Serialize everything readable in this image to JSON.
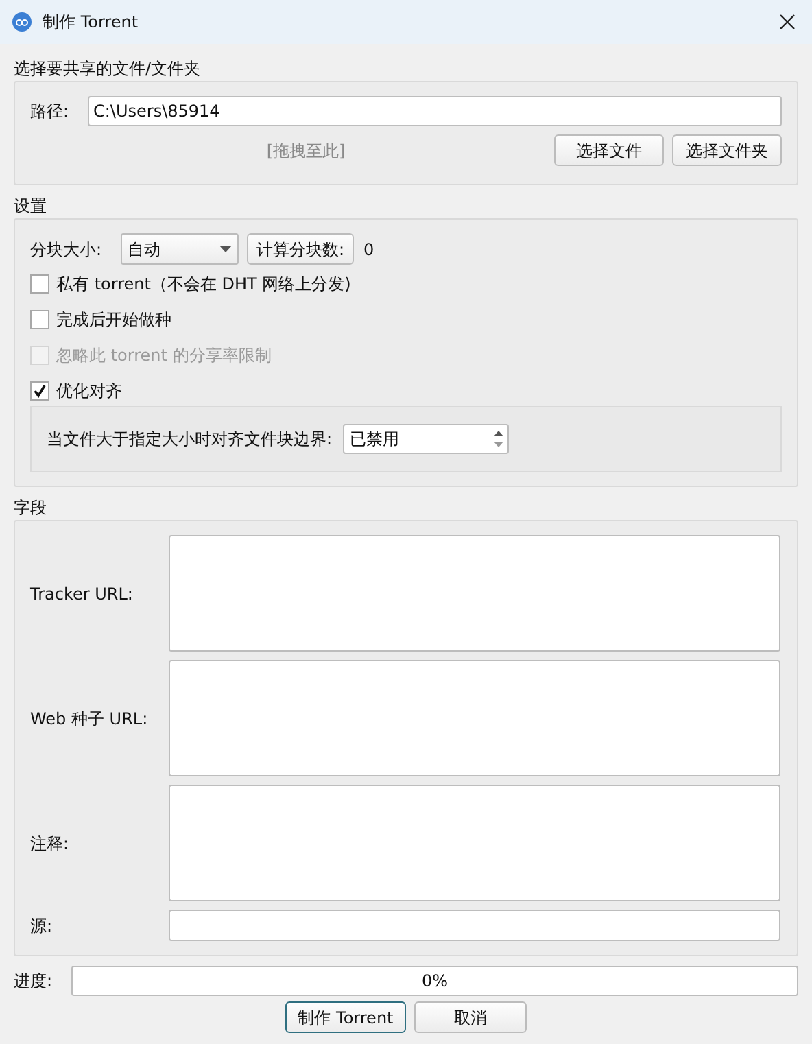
{
  "window": {
    "title": "制作 Torrent"
  },
  "source": {
    "title": "选择要共享的文件/文件夹",
    "path_label": "路径:",
    "path_value": "C:\\Users\\85914",
    "drop_hint": "[拖拽至此]",
    "buttons": [
      "选择文件",
      "选择文件夹"
    ]
  },
  "settings": {
    "title": "设置",
    "piece_size_label": "分块大小:",
    "piece_size_value": "自动",
    "calc_button": "计算分块数:",
    "piece_count": "0",
    "checkboxes": [
      {
        "label": "私有 torrent（不会在 DHT 网络上分发)",
        "checked": false,
        "disabled": false
      },
      {
        "label": "完成后开始做种",
        "checked": false,
        "disabled": false
      },
      {
        "label": "忽略此 torrent 的分享率限制",
        "checked": false,
        "disabled": true
      },
      {
        "label": "优化对齐",
        "checked": true,
        "disabled": false
      }
    ],
    "alignment": {
      "label": "当文件大于指定大小时对齐文件块边界:",
      "value": "已禁用"
    }
  },
  "fields": {
    "title": "字段",
    "rows": [
      {
        "label": "Tracker URL:",
        "kind": "multiline"
      },
      {
        "label": "Web 种子 URL:",
        "kind": "multiline"
      },
      {
        "label": "注释:",
        "kind": "multiline"
      },
      {
        "label": "源:",
        "kind": "line"
      }
    ]
  },
  "progress": {
    "label": "进度:",
    "level": 0,
    "text": "0%"
  },
  "buttons": [
    {
      "label": "制作 Torrent",
      "default": true
    },
    {
      "label": "取消",
      "default": false
    }
  ]
}
